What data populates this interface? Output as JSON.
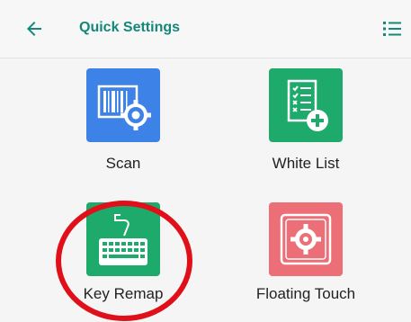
{
  "header": {
    "title": "Quick Settings",
    "back_icon": "arrow-left-icon",
    "menu_icon": "list-icon",
    "accent_color": "#14877a"
  },
  "tiles": [
    {
      "label": "Scan",
      "icon": "barcode-gear-icon",
      "color": "#3d82e6"
    },
    {
      "label": "White List",
      "icon": "checklist-add-icon",
      "color": "#1eaa6a"
    },
    {
      "label": "Key Remap",
      "icon": "keyboard-icon",
      "color": "#1eaa6a"
    },
    {
      "label": "Floating Touch",
      "icon": "gear-frame-icon",
      "color": "#ec6e76"
    }
  ],
  "annotation": {
    "type": "circle",
    "color": "#e0101a"
  }
}
